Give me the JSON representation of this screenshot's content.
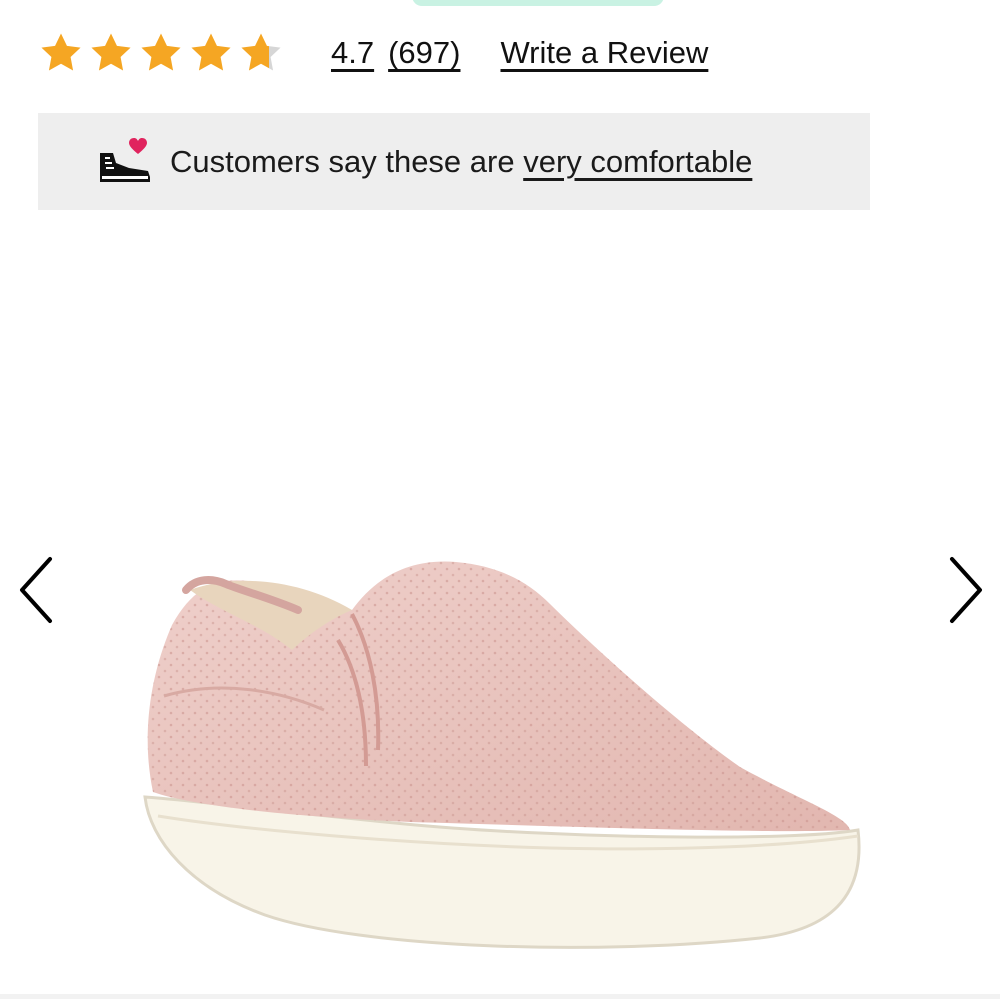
{
  "rating": {
    "average": "4.7",
    "count": "(697)",
    "write_review_label": "Write a Review",
    "stars_value": 4.7,
    "stars_max": 5,
    "star_color": "#f5a623"
  },
  "comfort_banner": {
    "prefix": "Customers say these are ",
    "link": "very comfortable",
    "icon": "sneaker-heart-icon",
    "heart_color": "#e0245e"
  },
  "carousel": {
    "prev_icon": "chevron-left-icon",
    "next_icon": "chevron-right-icon",
    "product_color": "#e8c3bd",
    "sole_color": "#f8f4e8"
  }
}
